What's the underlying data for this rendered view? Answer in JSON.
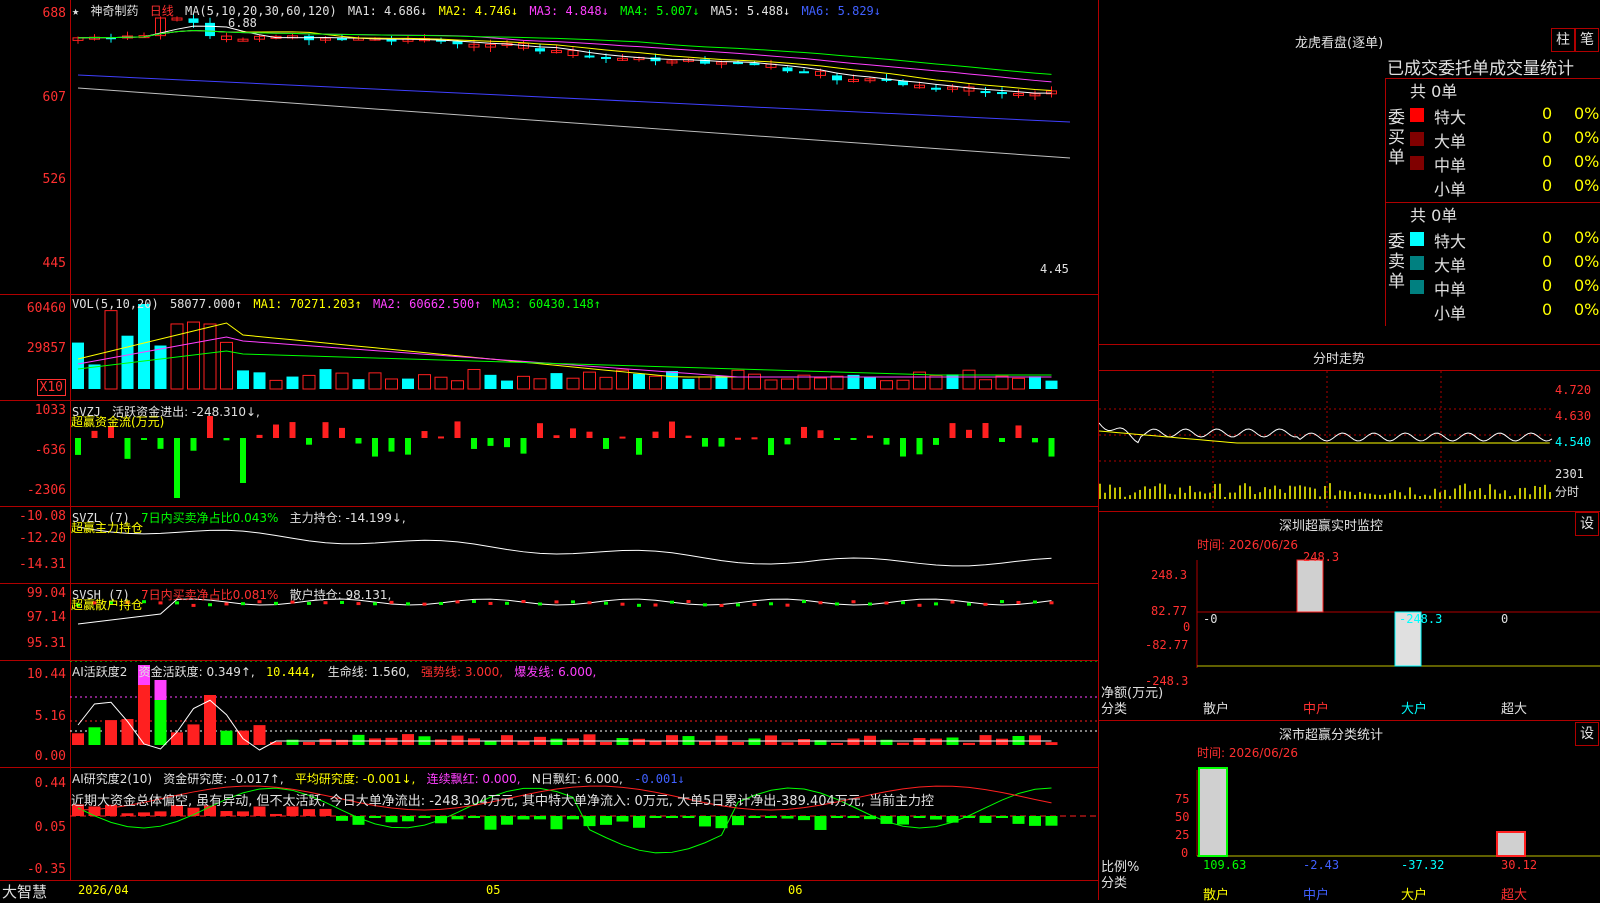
{
  "stock": {
    "star": "★",
    "name": "神奇制药",
    "period": "日线",
    "ma_label": "MA(5,10,20,30,60,120)",
    "ma1": "MA1: 4.686↓",
    "ma2": "MA2: 4.746↓",
    "ma3": "MA3: 4.848↓",
    "ma4": "MA4: 5.007↓",
    "ma5": "MA5: 5.488↓",
    "ma6": "MA6: 5.829↓",
    "high_mark": "6.88",
    "low_mark": "4.45",
    "axis": [
      "688",
      "607",
      "526",
      "445"
    ]
  },
  "vol": {
    "label": "VOL(5,10,20)",
    "value": "58077.000↑",
    "ma1": "MA1: 70271.203↑",
    "ma2": "MA2: 60662.500↑",
    "ma3": "MA3: 60430.148↑",
    "axis": [
      "60460",
      "29857",
      "X10"
    ]
  },
  "svzj": {
    "label": "SVZJ",
    "desc": "活跃资金进出: -248.310↓,",
    "title": "超赢资金流(万元)",
    "axis": [
      "1033",
      "-636",
      "-2306"
    ]
  },
  "svzl": {
    "label": "SVZL (7)",
    "ratio": "7日内买卖净占比0.043%",
    "hold": "主力持仓: -14.199↓,",
    "title": "超赢主力持仓",
    "axis": [
      "-10.08",
      "-12.20",
      "-14.31"
    ]
  },
  "svsh": {
    "label": "SVSH (7)",
    "ratio": "7日内买卖净占比0.081%",
    "hold": "散户持仓: 98.131,",
    "title": "超赢散户持仓",
    "axis": [
      "99.04",
      "97.14",
      "95.31"
    ]
  },
  "ai1": {
    "label": "AI活跃度2",
    "v1": "资金活跃度: 0.349↑,",
    "v2": "10.444,",
    "v3": "生命线: 1.560,",
    "v4": "强势线: 3.000,",
    "v5": "爆发线: 6.000,",
    "axis": [
      "10.44",
      "5.16",
      "0.00"
    ]
  },
  "ai2": {
    "label": "AI研究度2(10)",
    "v1": "资金研究度: -0.017↑,",
    "v2": "平均研究度: -0.001↓,",
    "v3": "连续飘红: 0.000,",
    "v4": "N日飘红: 6.000,",
    "v5": "-0.001↓",
    "note": "近期大资金总体偏空, 虽有异动, 但不太活跃, 今日大单净流出: -248.304万元, 其中特大单净流入: 0万元, 大单5日累计净出-389.404万元, 当前主力控",
    "axis": [
      "0.44",
      "0.05",
      "-0.35"
    ]
  },
  "footer": {
    "brand": "大智慧",
    "dates": [
      "2026/04",
      "05",
      "06"
    ]
  },
  "right": {
    "buttons": [
      "柱",
      "笔"
    ],
    "lhb_title": "龙虎看盘(逐单)",
    "lhb_sub": "已成交委托单成交量统计",
    "buy": {
      "side": "委买单",
      "total": "共 0单",
      "rows": [
        {
          "n": "特大",
          "v": "0",
          "p": "0%",
          "c": "#ff0000"
        },
        {
          "n": "大单",
          "v": "0",
          "p": "0%",
          "c": "#800000"
        },
        {
          "n": "中单",
          "v": "0",
          "p": "0%",
          "c": "#800000"
        },
        {
          "n": "小单",
          "v": "0",
          "p": "0%",
          "c": ""
        }
      ]
    },
    "sell": {
      "side": "委卖单",
      "total": "共 0单",
      "rows": [
        {
          "n": "特大",
          "v": "0",
          "p": "0%",
          "c": "#00ffff"
        },
        {
          "n": "大单",
          "v": "0",
          "p": "0%",
          "c": "#008080"
        },
        {
          "n": "中单",
          "v": "0",
          "p": "0%",
          "c": "#008080"
        },
        {
          "n": "小单",
          "v": "0",
          "p": "0%",
          "c": ""
        }
      ]
    },
    "fs_title": "分时走势",
    "fs_axis": [
      "4.720",
      "4.630",
      "4.540",
      "2301",
      "分时"
    ],
    "sz_title": "深圳超赢实时监控",
    "set": "设",
    "sz_time": "时间: 2026/06/26",
    "sz_axis": [
      "248.3",
      "82.77",
      "0",
      "-82.77",
      "-248.3"
    ],
    "sz_vals": [
      "-0",
      "248.3",
      "-248.3",
      "0"
    ],
    "sz_unit": "净额(万元)",
    "cls": "分类",
    "cats": [
      "散户",
      "中户",
      "大户",
      "超大"
    ],
    "st_title": "深市超赢分类统计",
    "st_time": "时间: 2026/06/26",
    "st_axis": [
      "75",
      "50",
      "25",
      "0"
    ],
    "st_unit": "比例%",
    "st_vals": [
      "109.63",
      "-2.43",
      "-37.32",
      "30.12"
    ]
  }
}
